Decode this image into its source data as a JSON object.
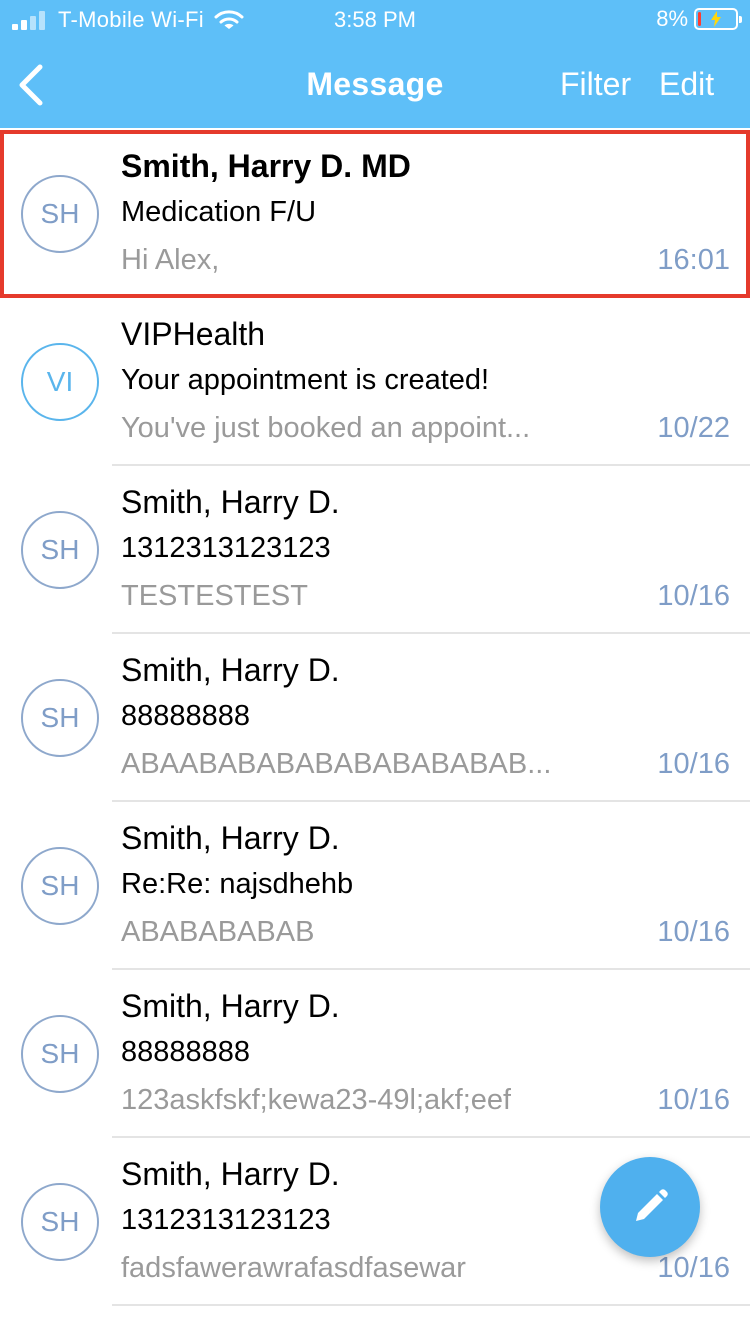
{
  "status_bar": {
    "carrier": "T-Mobile Wi-Fi",
    "time": "3:58 PM",
    "battery_percent": "8%",
    "battery_level": 0.08,
    "icons": [
      "signal-icon",
      "wifi-icon",
      "battery-icon"
    ]
  },
  "nav": {
    "back_icon": "chevron-left-icon",
    "title": "Message",
    "filter_label": "Filter",
    "edit_label": "Edit"
  },
  "colors": {
    "header_bg": "#5ebff8",
    "selection_outline": "#e53a2c",
    "avatar_accent": "#7f9dc7",
    "timestamp": "#7f9dc7",
    "preview_text": "#9a9a9a",
    "fab_bg": "#4fb0ee"
  },
  "messages": [
    {
      "avatar": "SH",
      "sender": "Smith, Harry D.  MD",
      "subject": "Medication F/U",
      "preview": "Hi Alex,",
      "time": "16:01",
      "selected": true,
      "unread": true
    },
    {
      "avatar": "VI",
      "sender": "VIPHealth",
      "subject": "Your appointment is created!",
      "preview": "You've just booked an appoint...",
      "time": "10/22"
    },
    {
      "avatar": "SH",
      "sender": "Smith, Harry D.",
      "subject": "1312313123123",
      "preview": "TESTESTEST",
      "time": "10/16"
    },
    {
      "avatar": "SH",
      "sender": "Smith, Harry D.",
      "subject": "88888888",
      "preview": "ABAABABABABABABABABAB...",
      "time": "10/16"
    },
    {
      "avatar": "SH",
      "sender": "Smith, Harry D.",
      "subject": "Re:Re: najsdhehb",
      "preview": "ABABABABAB",
      "time": "10/16"
    },
    {
      "avatar": "SH",
      "sender": "Smith, Harry D.",
      "subject": "88888888",
      "preview": "123askfskf;kewa23-49l;akf;eef",
      "time": "10/16"
    },
    {
      "avatar": "SH",
      "sender": "Smith, Harry D.",
      "subject": "1312313123123",
      "preview": "fadsfawerawrafasdfasewar",
      "time": "10/16"
    }
  ],
  "fab": {
    "icon": "pencil-icon"
  }
}
